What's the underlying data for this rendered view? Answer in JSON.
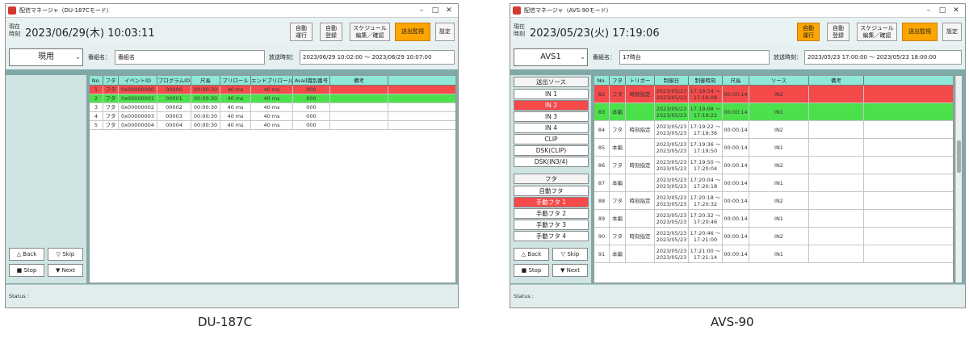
{
  "colors": {
    "red": "#f44a4a",
    "green": "#4de04d",
    "accent": "#ffa500",
    "header_cyan": "#8ee8d9",
    "panel": "#7fa9a7"
  },
  "icons": {
    "app": "app-logo-icon",
    "minimize": "minimize-icon",
    "maximize": "maximize-icon",
    "close": "close-icon",
    "dropdown": "chevron-down-icon"
  },
  "left": {
    "caption": "DU-187C",
    "window_title": "配信マネージャ（DU-187Cモード）",
    "clock_label": "現在時刻",
    "clock": "2023/06/29(木) 10:03:11",
    "buttons": {
      "auto_run": "自動\n運行",
      "auto_reg": "自動\n登録",
      "schedule": "スケジュール\n編集／確認",
      "monitor": "送出監視",
      "settings": "設定"
    },
    "select_value": "現用",
    "program_label": "番組名：",
    "program_name": "番組名",
    "airtime_label": "放送時刻：",
    "airtime": "2023/06/29 10:02:00 〜 2023/06/29 10:07:00",
    "controls": {
      "back": "△ Back",
      "skip": "▽ Skip",
      "stop": "■ Stop",
      "next": "▼ Next"
    },
    "columns": [
      "No.",
      "フタ",
      "イベントID",
      "プログラムID",
      "尺長",
      "プリロール",
      "エンドプリロール",
      "Avail識別番号",
      "備考",
      ""
    ],
    "rows": [
      {
        "state": "red",
        "cells": [
          "1",
          "フタ",
          "0x00000000",
          "00000",
          "00:00:30",
          "40 ms",
          "40 ms",
          "000",
          "",
          ""
        ]
      },
      {
        "state": "green",
        "cells": [
          "2",
          "フタ",
          "0x00000001",
          "00001",
          "00:00:30",
          "40 ms",
          "40 ms",
          "000",
          "",
          ""
        ]
      },
      {
        "state": "",
        "cells": [
          "3",
          "フタ",
          "0x00000002",
          "00002",
          "00:00:30",
          "40 ms",
          "40 ms",
          "000",
          "",
          ""
        ]
      },
      {
        "state": "",
        "cells": [
          "4",
          "フタ",
          "0x00000003",
          "00003",
          "00:00:30",
          "40 ms",
          "40 ms",
          "000",
          "",
          ""
        ]
      },
      {
        "state": "",
        "cells": [
          "5",
          "フタ",
          "0x00000004",
          "00004",
          "00:00:30",
          "40 ms",
          "40 ms",
          "000",
          "",
          ""
        ]
      }
    ],
    "status": "Status :"
  },
  "right": {
    "caption": "AVS-90",
    "window_title": "配信マネージャ（AVS-90モード）",
    "clock_label": "現在時刻",
    "clock": "2023/05/23(火) 17:19:06",
    "buttons": {
      "auto_run": "自動\n運行",
      "auto_reg": "自動\n登録",
      "schedule": "スケジュール\n編集／確認",
      "monitor": "送出監視",
      "settings": "設定"
    },
    "select_value": "AVS1",
    "program_label": "番組名：",
    "program_name": "17時台",
    "airtime_label": "放送時刻：",
    "airtime": "2023/05/23 17:00:00 〜 2023/05/23 18:00:00",
    "sources_title": "送出ソース",
    "sources": [
      "IN 1",
      "IN 2",
      "IN 3",
      "IN 4",
      "CLIP",
      "DSK(CLIP)",
      "DSK(IN3/4)"
    ],
    "futa_title": "フタ",
    "futa_items": [
      "自動フタ",
      "手動フタ 1",
      "手動フタ 2",
      "手動フタ 3",
      "手動フタ 4"
    ],
    "controls": {
      "back": "△ Back",
      "skip": "▽ Skip",
      "stop": "■ Stop",
      "next": "▼ Next"
    },
    "columns": [
      "No.",
      "フタ",
      "トリガー",
      "制御日",
      "制御時刻",
      "尺長",
      "ソース",
      "備考",
      ""
    ],
    "rows": [
      {
        "state": "red",
        "cells": [
          "82",
          "フタ",
          "時刻指定",
          "2023/05/23\n2023/05/23",
          "17:18:54 〜\n17:19:08",
          "00:00:14",
          "IN2",
          "",
          ""
        ]
      },
      {
        "state": "green",
        "cells": [
          "83",
          "本編",
          "",
          "2023/05/23\n2023/05/23",
          "17:19:08 〜\n17:19:22",
          "00:00:14",
          "IN1",
          "",
          ""
        ]
      },
      {
        "state": "",
        "cells": [
          "84",
          "フタ",
          "時刻指定",
          "2023/05/23\n2023/05/23",
          "17:19:22 〜\n17:19:36",
          "00:00:14",
          "IN2",
          "",
          ""
        ]
      },
      {
        "state": "",
        "cells": [
          "85",
          "本編",
          "",
          "2023/05/23\n2023/05/23",
          "17:19:36 〜\n17:19:50",
          "00:00:14",
          "IN1",
          "",
          ""
        ]
      },
      {
        "state": "",
        "cells": [
          "86",
          "フタ",
          "時刻指定",
          "2023/05/23\n2023/05/23",
          "17:19:50 〜\n17:20:04",
          "00:00:14",
          "IN2",
          "",
          ""
        ]
      },
      {
        "state": "",
        "cells": [
          "87",
          "本編",
          "",
          "2023/05/23\n2023/05/23",
          "17:20:04 〜\n17:20:18",
          "00:00:14",
          "IN1",
          "",
          ""
        ]
      },
      {
        "state": "",
        "cells": [
          "88",
          "フタ",
          "時刻指定",
          "2023/05/23\n2023/05/23",
          "17:20:18 〜\n17:20:32",
          "00:00:14",
          "IN2",
          "",
          ""
        ]
      },
      {
        "state": "",
        "cells": [
          "89",
          "本編",
          "",
          "2023/05/23\n2023/05/23",
          "17:20:32 〜\n17:20:46",
          "00:00:14",
          "IN1",
          "",
          ""
        ]
      },
      {
        "state": "",
        "cells": [
          "90",
          "フタ",
          "時刻指定",
          "2023/05/23\n2023/05/23",
          "17:20:46 〜\n17:21:00",
          "00:00:14",
          "IN2",
          "",
          ""
        ]
      },
      {
        "state": "",
        "cells": [
          "91",
          "本編",
          "",
          "2023/05/23\n2023/05/23",
          "17:21:00 〜\n17:21:14",
          "00:00:14",
          "IN1",
          "",
          ""
        ]
      }
    ],
    "status": "Status :"
  }
}
